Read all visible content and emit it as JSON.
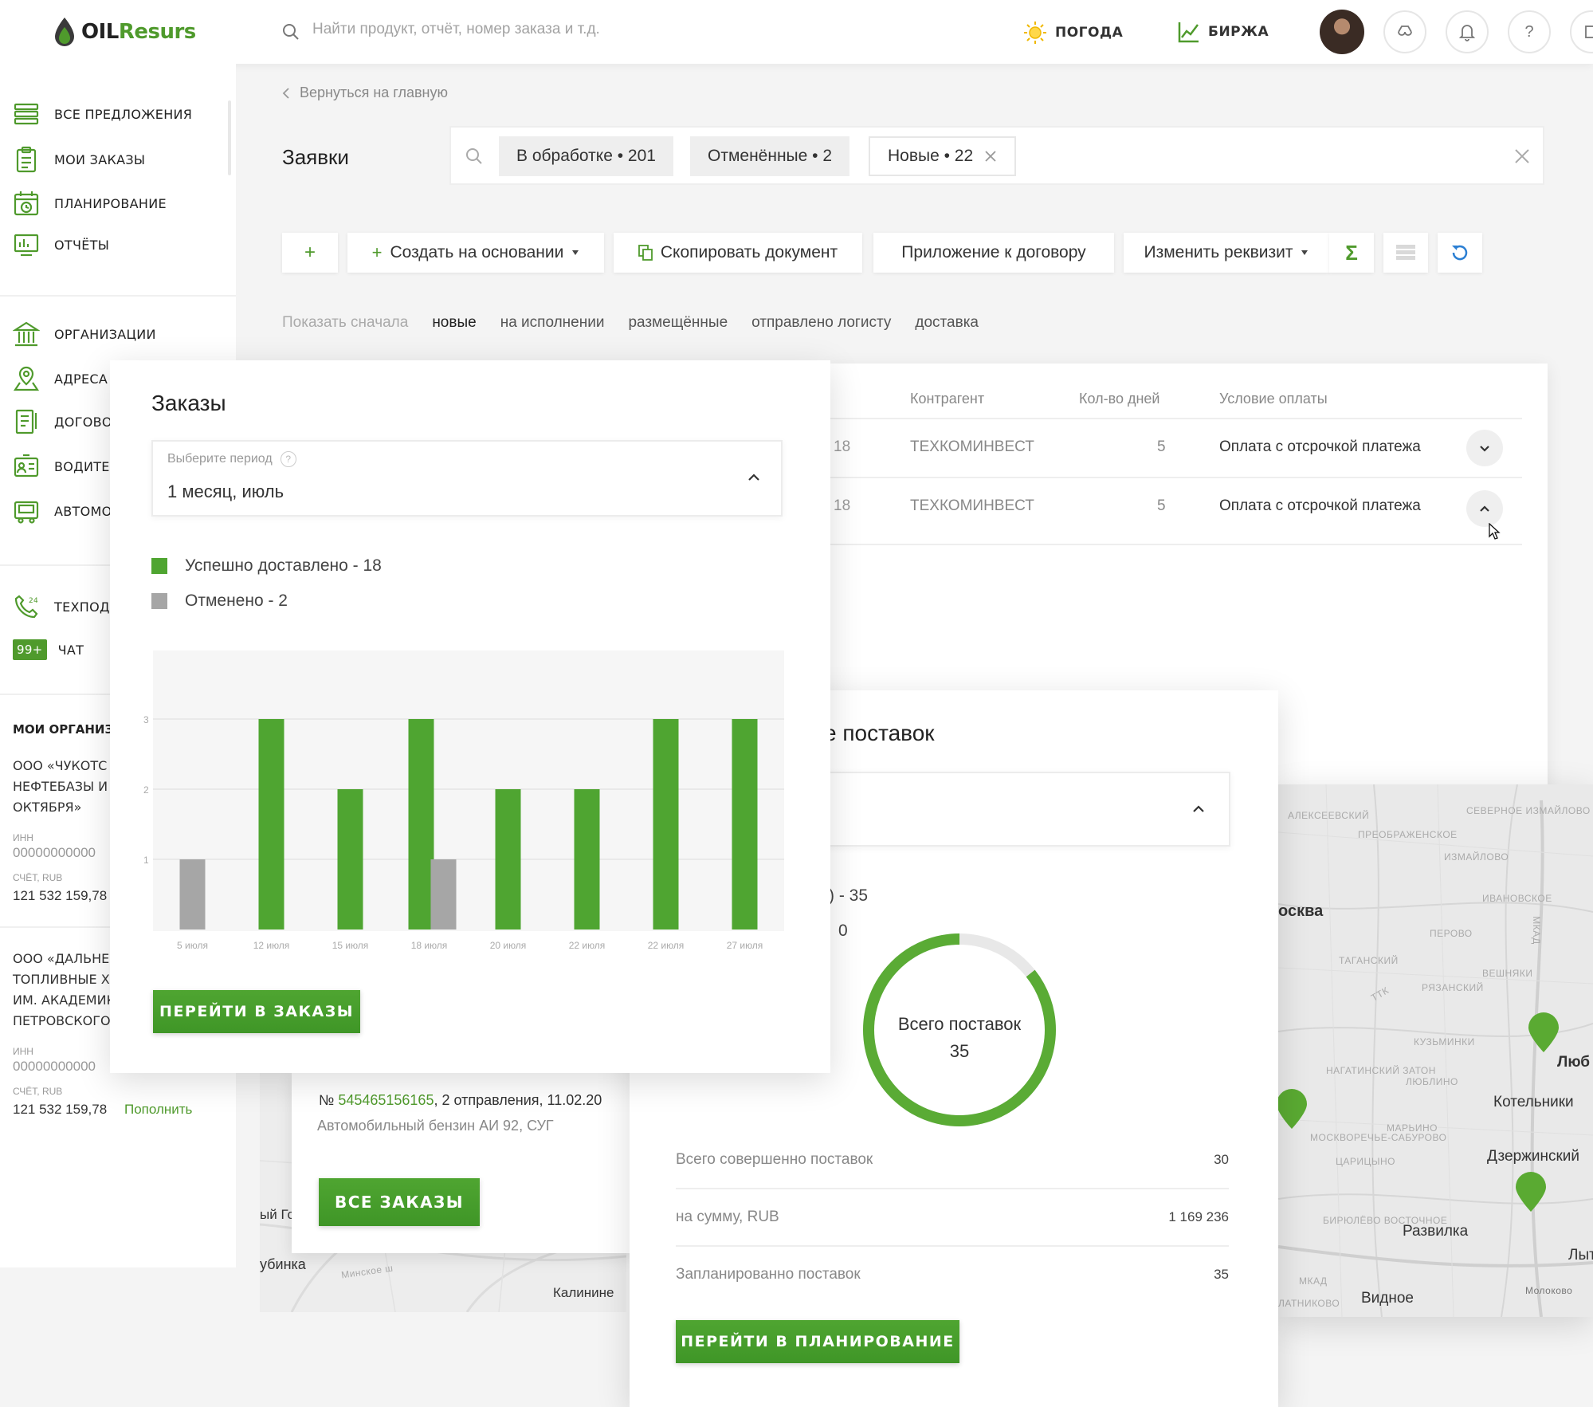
{
  "header": {
    "logo_text_dark": "OIL",
    "logo_text_green": "Resurs",
    "search_placeholder": "Найти продукт, отчёт, номер заказа и т.д.",
    "weather_label": "ПОГОДА",
    "exchange_label": "БИРЖА"
  },
  "sidebar": {
    "items": [
      {
        "label": "ВСЕ ПРЕДЛОЖЕНИЯ",
        "icon": "list-icon"
      },
      {
        "label": "МОИ ЗАКАЗЫ",
        "icon": "clipboard-icon"
      },
      {
        "label": "ПЛАНИРОВАНИЕ",
        "icon": "calendar-clock-icon"
      },
      {
        "label": "ОТЧЁТЫ",
        "icon": "report-icon"
      },
      {
        "label": "ОРГАНИЗАЦИИ",
        "icon": "building-icon"
      },
      {
        "label": "АДРЕСА",
        "icon": "map-pin-icon"
      },
      {
        "label": "ДОГОВО",
        "icon": "contract-icon"
      },
      {
        "label": "ВОДИТЕ",
        "icon": "driver-card-icon"
      },
      {
        "label": "АВТОМО",
        "icon": "truck-icon"
      },
      {
        "label": "ТЕХПОД",
        "icon": "phone-24-icon"
      },
      {
        "label": "ЧАТ",
        "badge": "99+"
      }
    ],
    "my_orgs_title": "МОИ ОРГАНИЗ",
    "orgs": [
      {
        "name_lines": [
          "ООО «ЧУКОТС",
          "НЕФТЕБАЗЫ И",
          "ОКТЯБРЯ»"
        ],
        "inn_label": "ИНН",
        "inn": "00000000000",
        "account_label": "СЧЁТ, RUB",
        "balance": "121 532 159,78"
      },
      {
        "name_lines": [
          "ООО «ДАЛЬНЕ",
          "ТОПЛИВНЫЕ Х",
          "ИМ. АКАДЕМИК",
          "ПЕТРОВСКОГО"
        ],
        "inn_label": "ИНН",
        "inn": "00000000000",
        "account_label": "СЧЁТ, RUB",
        "balance": "121 532 159,78",
        "topup": "Пополнить"
      }
    ]
  },
  "main": {
    "breadcrumb": "Вернуться на главную",
    "title": "Заявки",
    "filter_chips": [
      "В обработке • 201",
      "Отменённые • 2",
      "Новые • 22"
    ],
    "toolbar": {
      "add": "+",
      "create_based": "Создать на основании",
      "copy_doc": "Скопировать документ",
      "contract_app": "Приложение к договору",
      "change_req": "Изменить реквизит"
    },
    "sort": {
      "label": "Показать сначала",
      "options": [
        "новые",
        "на исполнении",
        "размещённые",
        "отправлено логисту",
        "доставка"
      ]
    },
    "table": {
      "columns": [
        "Контрагент",
        "Кол-во дней",
        "Условие оплаты"
      ],
      "rows": [
        {
          "partial": "18",
          "counterparty": "ТЕХКОМИНВЕСТ",
          "days": "5",
          "payment": "Оплата с отсрочкой платежа"
        },
        {
          "partial": "18",
          "counterparty": "ТЕХКОМИНВЕСТ",
          "days": "5",
          "payment": "Оплата с отсрочкой платежа"
        }
      ]
    }
  },
  "orders_widget": {
    "title": "Заказы",
    "period_label": "Выберите период",
    "period_value": "1 месяц, июль",
    "legend": [
      {
        "label": "Успешно доставлено - 18",
        "color": "#4fa531"
      },
      {
        "label": "Отменено - 2",
        "color": "#a6a6a6"
      }
    ],
    "button": "ПЕРЕЙТИ В ЗАКАЗЫ"
  },
  "chart_data": {
    "type": "bar",
    "categories": [
      "5 июля",
      "12 июля",
      "15 июля",
      "18 июля",
      "20 июля",
      "22 июля",
      "22 июля",
      "27 июля"
    ],
    "series": [
      {
        "values": [
          0,
          3,
          2,
          3,
          2,
          2,
          3,
          3
        ],
        "color": "#4fa531"
      },
      {
        "values": [
          1,
          0,
          0,
          1,
          0,
          0,
          0,
          0
        ],
        "color": "#a6a6a6"
      }
    ],
    "y_ticks": [
      "1",
      "2",
      "3"
    ],
    "ylim": [
      0,
      3
    ],
    "grid": true
  },
  "supplies_widget": {
    "title_fragment": "е поставок",
    "legend_fragment_1": ") - 35",
    "legend_fragment_2": "0",
    "donut_label": "Всего поставок",
    "donut_total": "35",
    "donut_completed": 30,
    "stats": [
      {
        "label": "Всего совершенно поставок",
        "value": "30"
      },
      {
        "label": "на сумму, RUB",
        "value": "1 169 236"
      },
      {
        "label": "Запланированно поставок",
        "value": "35"
      }
    ],
    "button": "ПЕРЕЙТИ В ПЛАНИРОВАНИЕ"
  },
  "map": {
    "labels": [
      "осква",
      "Люб",
      "Котельники",
      "Дзержинский",
      "Развилка",
      "Лыт",
      "Видное",
      "Молоково"
    ],
    "small_labels": [
      "АЛЕКСЕЕВСКИЙ",
      "СЕВЕРНОЕ ИЗМАЙЛОВО",
      "ПРЕОБРАЖЕНСКОЕ",
      "ИЗМАЙЛОВО",
      "ИВАНОВСКОЕ",
      "ПЕРОВО",
      "ТАГАНСКИЙ",
      "РЯЗАНСКИЙ",
      "ВЕШНЯКИ",
      "ТТК",
      "МКАД",
      "КУЗЬМИНКИ",
      "НАГАТИНСКИЙ ЗАТОН",
      "ЛЮБЛИНО",
      "МАРЬИНО",
      "ЦАРИЦЫНО",
      "БИРЮЛЁВО ВОСТОЧНОЕ",
      "МКАД",
      "ЛАТНИКОВО",
      "МОСКВОРЕЧЬЕ-САБУРОВО"
    ]
  },
  "bottom_order": {
    "number_prefix": "№",
    "number": "545465156165",
    "details": ", 2 отправления, 11.02.20",
    "product": "Автомобильный бензин АИ 92, СУГ",
    "button": "ВСЕ ЗАКАЗЫ",
    "map_labels": [
      "ый Го",
      "убинка",
      "Минское ш",
      "Калинине"
    ]
  }
}
